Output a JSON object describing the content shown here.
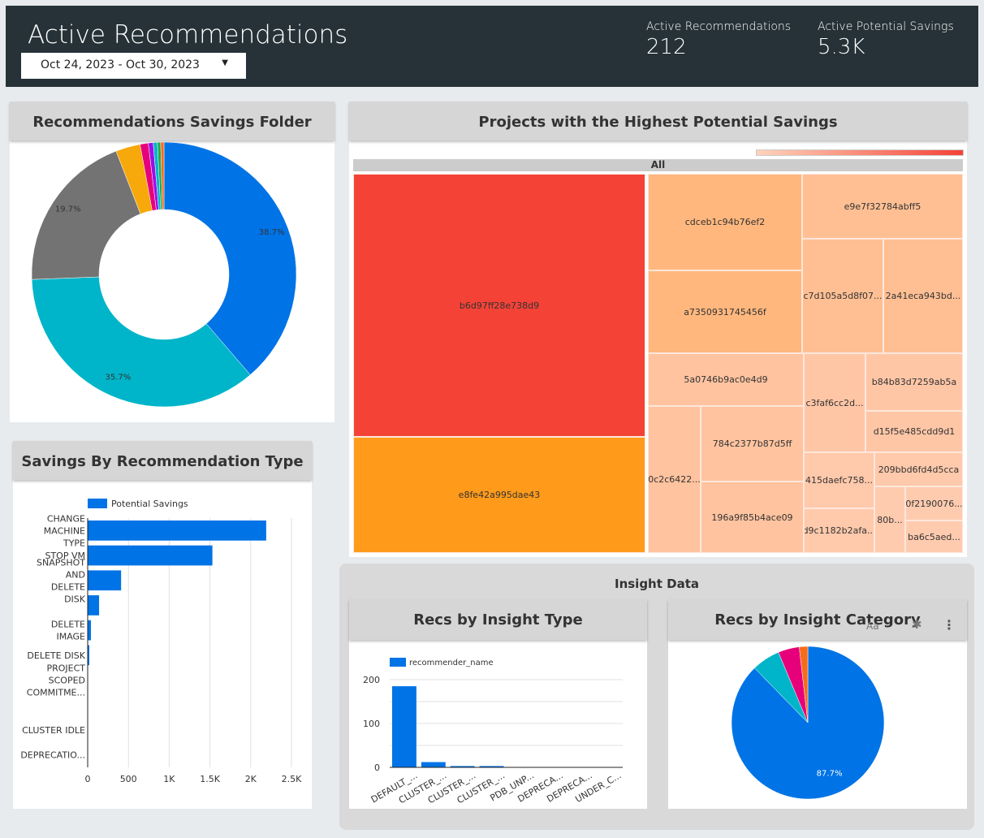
{
  "header": {
    "title": "Active Recommendations",
    "date_range": "Oct 24, 2023 - Oct 30, 2023",
    "kpis": [
      {
        "label": "Active Recommendations",
        "value": "212"
      },
      {
        "label": "Active Potential Savings",
        "value": "5.3K"
      }
    ]
  },
  "colors": {
    "header_bg": "#263238",
    "primary": "#0073e6"
  },
  "donut": {
    "title": "Recommendations Savings Folder",
    "chart_data": {
      "type": "pie",
      "donut": true,
      "slices": [
        {
          "value": 38.7,
          "label": "38.7%",
          "color": "#0073e6"
        },
        {
          "value": 35.7,
          "label": "35.7%",
          "color": "#00b5c9"
        },
        {
          "value": 19.7,
          "label": "19.7%",
          "color": "#737373"
        },
        {
          "value": 3.0,
          "color": "#f7a80a"
        },
        {
          "value": 1.0,
          "color": "#e6007a"
        },
        {
          "value": 0.6,
          "color": "#9b0fe6"
        },
        {
          "value": 0.5,
          "color": "#00b5c9"
        },
        {
          "value": 0.4,
          "color": "#1ea852"
        },
        {
          "value": 0.4,
          "color": "#f76b1c"
        }
      ]
    }
  },
  "treemap": {
    "title": "Projects with the Highest Potential Savings",
    "root": "All",
    "items": [
      "b6d97ff28e738d9",
      "e8fe42a995dae43",
      "cdceb1c94b76ef2",
      "a7350931745456f",
      "e9e7f32784abff5",
      "c7d105a5d8f07...",
      "2a41eca943bd...",
      "5a0746b9ac0e4d9",
      "0c2c6422...",
      "784c2377b87d5ff",
      "196a9f85b4ace09",
      "c3faf6cc2d...",
      "b84b83d7259ab5a",
      "d15f5e485cdd9d1",
      "415daefc758...",
      "209bbd6fd4d5cca",
      "d9c1182b2afa...",
      "80b...",
      "0f2190076...",
      "ba6c5aed..."
    ]
  },
  "bar": {
    "title": "Savings By Recommendation Type",
    "chart_data": {
      "type": "bar",
      "orientation": "horizontal",
      "legend": "Potential Savings",
      "legend_position": "top",
      "categories": [
        "CHANGE MACHINE TYPE",
        "STOP VM",
        "SNAPSHOT AND DELETE DISK",
        "",
        "DELETE IMAGE",
        "DELETE DISK",
        "PROJECT SCOPED COMMITME...",
        "",
        "CLUSTER IDLE",
        "DEPRECATIO..."
      ],
      "values": [
        2190,
        1530,
        410,
        140,
        40,
        20,
        5,
        0,
        0,
        0
      ],
      "xlim": [
        0,
        2500
      ],
      "xticks": [
        "0",
        "500",
        "1K",
        "1.5K",
        "2K",
        "2.5K"
      ],
      "grid": true
    }
  },
  "insight": {
    "title": "Insight Data",
    "type_chart": {
      "title": "Recs by Insight Type",
      "chart_data": {
        "type": "bar",
        "legend": "recommender_name",
        "legend_position": "top",
        "categories": [
          "DEFAULT_...",
          "CLUSTER_...",
          "CLUSTER_...",
          "CLUSTER_...",
          "PDB_UNP...",
          "DEPRECA...",
          "DEPRECA...",
          "UNDER_C..."
        ],
        "values": [
          185,
          12,
          3,
          3,
          0,
          0,
          0,
          0
        ],
        "ylim": [
          0,
          200
        ],
        "yticks": [
          "0",
          "100",
          "200"
        ],
        "grid": true
      }
    },
    "category_chart": {
      "title": "Recs by Insight Category",
      "chart_data": {
        "type": "pie",
        "slices": [
          {
            "value": 87.7,
            "label": "87.7%",
            "color": "#0073e6"
          },
          {
            "value": 6.0,
            "color": "#00b5c9"
          },
          {
            "value": 4.5,
            "color": "#e6007a"
          },
          {
            "value": 1.8,
            "color": "#f76b1c"
          }
        ]
      }
    }
  }
}
